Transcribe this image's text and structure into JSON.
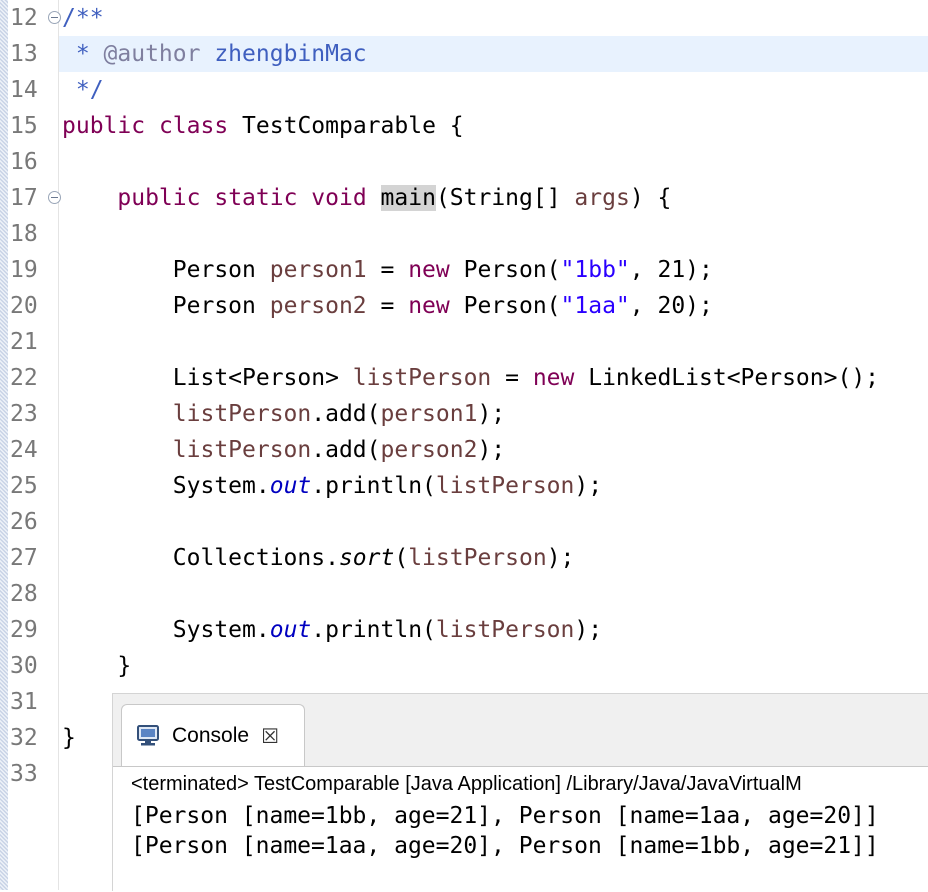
{
  "editor": {
    "line_numbers": [
      "12",
      "13",
      "14",
      "15",
      "16",
      "17",
      "18",
      "19",
      "20",
      "21",
      "22",
      "23",
      "24",
      "25",
      "26",
      "27",
      "28",
      "29",
      "30",
      "31",
      "32",
      "33"
    ],
    "lines": {
      "l12": {
        "t1": "/**"
      },
      "l13": {
        "t1": " * ",
        "t2": "@author",
        "t3": " zhengbinMac"
      },
      "l14": {
        "t1": " */"
      },
      "l15": {
        "t1": "public",
        "t2": " ",
        "t3": "class",
        "t4": " TestComparable {"
      },
      "l17": {
        "t1": "    ",
        "t2": "public",
        "t3": " ",
        "t4": "static",
        "t5": " ",
        "t6": "void",
        "t7": " ",
        "t8": "main",
        "t9": "(String[] ",
        "t10": "args",
        "t11": ") {"
      },
      "l19": {
        "t1": "        Person ",
        "t2": "person1",
        "t3": " = ",
        "t4": "new",
        "t5": " Person(",
        "t6": "\"1bb\"",
        "t7": ", 21);"
      },
      "l20": {
        "t1": "        Person ",
        "t2": "person2",
        "t3": " = ",
        "t4": "new",
        "t5": " Person(",
        "t6": "\"1aa\"",
        "t7": ", 20);"
      },
      "l22": {
        "t1": "        List<Person> ",
        "t2": "listPerson",
        "t3": " = ",
        "t4": "new",
        "t5": " LinkedList<Person>();"
      },
      "l23": {
        "t1": "        ",
        "t2": "listPerson",
        "t3": ".add(",
        "t4": "person1",
        "t5": ");"
      },
      "l24": {
        "t1": "        ",
        "t2": "listPerson",
        "t3": ".add(",
        "t4": "person2",
        "t5": ");"
      },
      "l25": {
        "t1": "        System.",
        "t2": "out",
        "t3": ".println(",
        "t4": "listPerson",
        "t5": ");"
      },
      "l27": {
        "t1": "        Collections.",
        "t2": "sort",
        "t3": "(",
        "t4": "listPerson",
        "t5": ");"
      },
      "l29": {
        "t1": "        System.",
        "t2": "out",
        "t3": ".println(",
        "t4": "listPerson",
        "t5": ");"
      },
      "l30": {
        "t1": "    }"
      },
      "l32": {
        "t1": "}"
      }
    }
  },
  "console": {
    "tab_label": "Console",
    "close_glyph": "☒",
    "status": "<terminated> TestComparable [Java Application] /Library/Java/JavaVirtualM",
    "output": [
      "[Person [name=1bb, age=21], Person [name=1aa, age=20]]",
      "[Person [name=1aa, age=20], Person [name=1bb, age=21]]"
    ]
  },
  "colors": {
    "keyword": "#7f0055",
    "comment": "#3f5fbf",
    "string": "#2a00ff",
    "local_var": "#6a3e3e",
    "static_field": "#0000c0",
    "current_line": "#e8f2fe"
  },
  "icons": {
    "console_tab": "console-icon",
    "close": "close-icon",
    "fold": "collapse-icon"
  }
}
